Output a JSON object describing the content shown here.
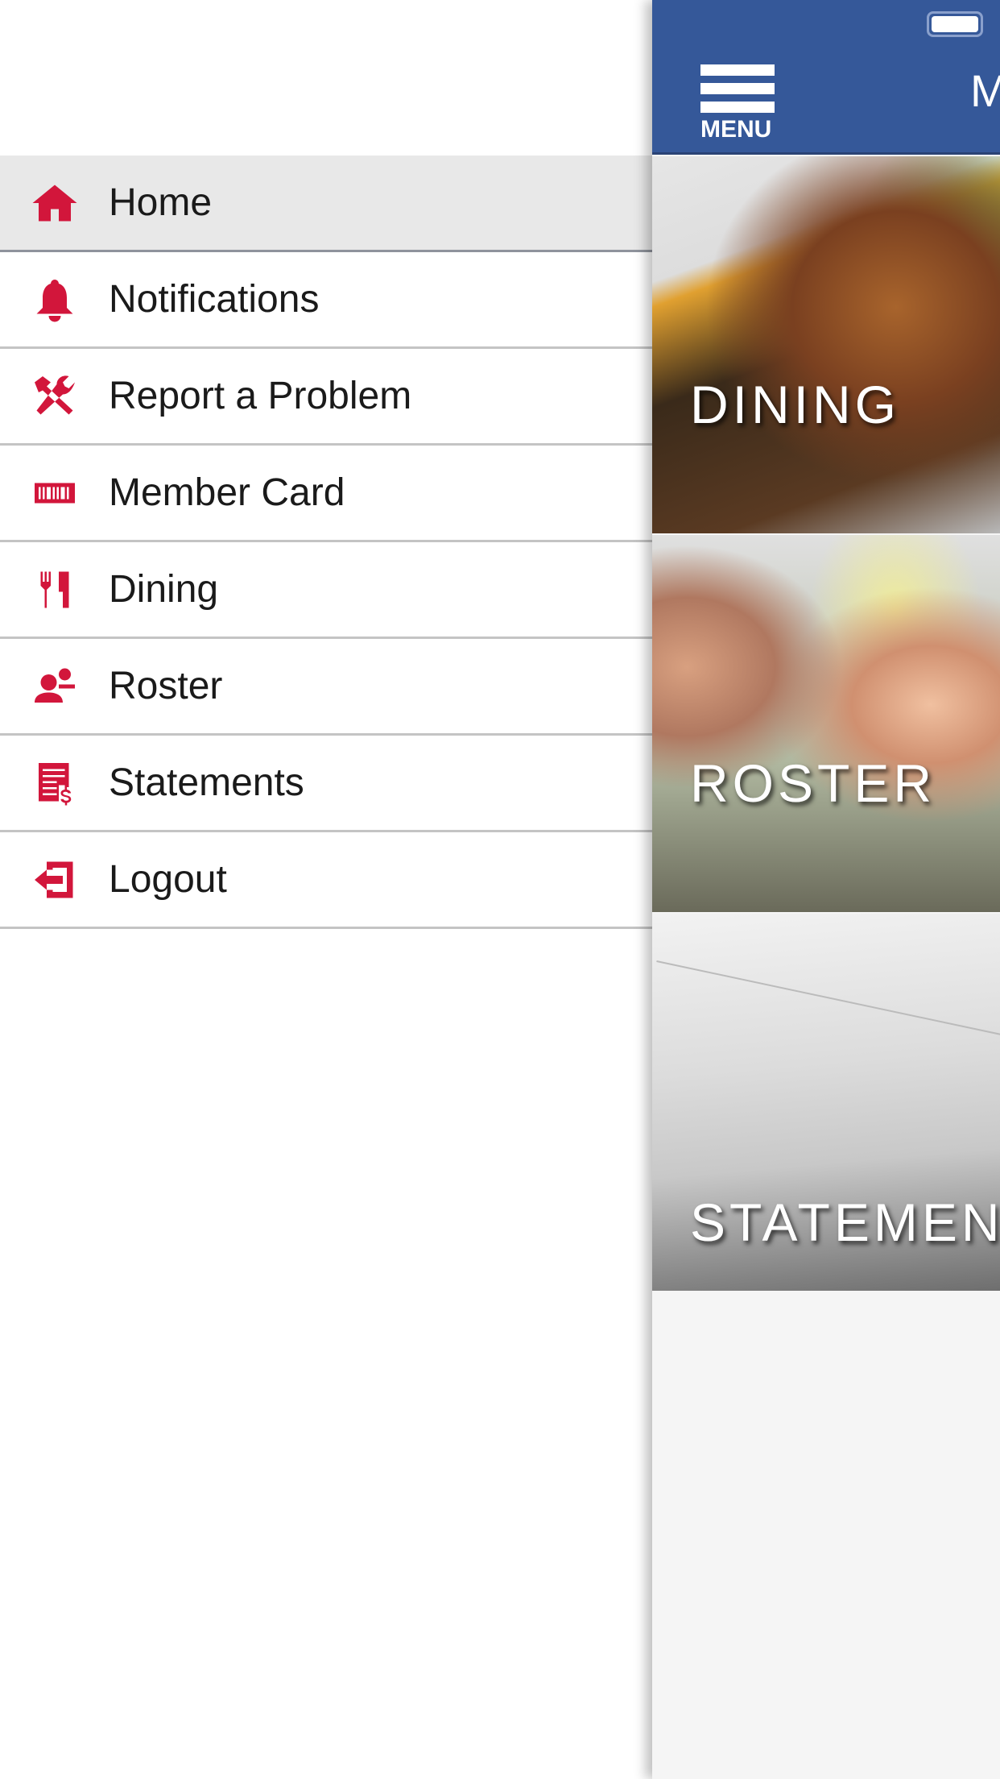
{
  "drawer": {
    "items": [
      {
        "label": "Home",
        "icon": "home-icon",
        "active": true
      },
      {
        "label": "Notifications",
        "icon": "bell-icon"
      },
      {
        "label": "Report a Problem",
        "icon": "tools-icon"
      },
      {
        "label": "Member Card",
        "icon": "barcode-icon"
      },
      {
        "label": "Dining",
        "icon": "fork-knife-icon"
      },
      {
        "label": "Roster",
        "icon": "people-icon"
      },
      {
        "label": "Statements",
        "icon": "statement-icon"
      },
      {
        "label": "Logout",
        "icon": "logout-icon"
      }
    ]
  },
  "header": {
    "menu_label": "MENU",
    "title": "M",
    "color": "#355899"
  },
  "tiles": [
    {
      "label": "DINING"
    },
    {
      "label": "ROSTER"
    },
    {
      "label": "STATEMEN"
    }
  ],
  "accent": "#d2163b"
}
